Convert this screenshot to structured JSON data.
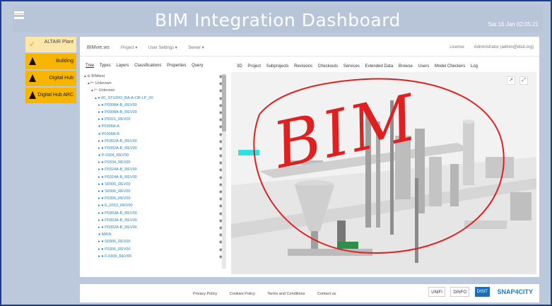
{
  "header": {
    "title": "BIM Integration Dashboard",
    "datetime": "Sat 16 Jan 02:05:21"
  },
  "sidebar": {
    "items": [
      {
        "label": "ALTAIR Plant",
        "active": true
      },
      {
        "label": "Building"
      },
      {
        "label": "Digital Hub"
      },
      {
        "label": "Digital Hub ARC"
      }
    ]
  },
  "app": {
    "brand": "BIMvie.ws",
    "nav": [
      "Project ▾",
      "User Settings ▾",
      "Server ▾"
    ],
    "right": [
      "License",
      "Administrator (admin@disit.org)"
    ]
  },
  "tree": {
    "tabs": [
      "Tree",
      "Types",
      "Layers",
      "Classifications",
      "Properties",
      "Query"
    ],
    "rows": [
      {
        "text": "▴ ⊖ BIMtest",
        "indent": 0
      },
      {
        "text": "▴ ⊢ Unknown",
        "indent": 1
      },
      {
        "text": "▴ ⊢ Unknown",
        "indent": 2
      },
      {
        "text": "▴ ● 00_STUDIO_BA-A-CR-LP_00",
        "indent": 3
      },
      {
        "text": "▸ ● P0308A-B_REV00",
        "indent": 4
      },
      {
        "text": "▸ ● P0308A-B_REV00",
        "indent": 4
      },
      {
        "text": "▸ ● P0321_REV00",
        "indent": 4
      },
      {
        "text": "● P0308A-A",
        "indent": 4
      },
      {
        "text": "● P0308A-B",
        "indent": 4
      },
      {
        "text": "▸ ● P0302A-B_REV00",
        "indent": 4
      },
      {
        "text": "▸ ● P0302A-B_REV00",
        "indent": 4
      },
      {
        "text": "● P-0304_REV00",
        "indent": 4
      },
      {
        "text": "▸ ● P0334_REV00",
        "indent": 4
      },
      {
        "text": "▸ ● P0324A-B_REV00",
        "indent": 4
      },
      {
        "text": "▸ ● P0324A-B_REV00",
        "indent": 4
      },
      {
        "text": "▸ ● S0306_REV00",
        "indent": 4
      },
      {
        "text": "▸ ● S0306_REV00",
        "indent": 4
      },
      {
        "text": "▸ ● P0306_REV00",
        "indent": 4
      },
      {
        "text": "▸ ● E_0313_REV00",
        "indent": 4
      },
      {
        "text": "▸ ● P0303A-B_REV00",
        "indent": 4
      },
      {
        "text": "▸ ● P0303A-B_REV00",
        "indent": 4
      },
      {
        "text": "▸ ● P0302A-B_REV00",
        "indent": 4
      },
      {
        "text": "● MAIN",
        "indent": 4
      },
      {
        "text": "▸ ● S0306_REV00",
        "indent": 4
      },
      {
        "text": "▸ ● P0306_REV00",
        "indent": 4
      },
      {
        "text": "▸ ● F-0305_REV00",
        "indent": 4
      }
    ]
  },
  "view": {
    "tabs": [
      "3D",
      "Project",
      "Subprojects",
      "Revisions",
      "Checkouts",
      "Services",
      "Extended Data",
      "Browse",
      "Users",
      "Model Checkers",
      "Log"
    ],
    "annotation": "BIM"
  },
  "footer": {
    "links": [
      "Privacy Policy",
      "Cookies Policy",
      "Terms and Conditions",
      "Contact us"
    ],
    "logos": [
      "UNIFI",
      "DINFO",
      "DISIT",
      "SNAP4CITY"
    ]
  },
  "colors": {
    "frame_border": "#1f3b8c",
    "frame_bg": "#bcc9dc",
    "sidebar_item": "#f7b500",
    "sidebar_active": "#fde7a8",
    "annotation": "#e02020",
    "tree_link": "#2a7fbf"
  }
}
